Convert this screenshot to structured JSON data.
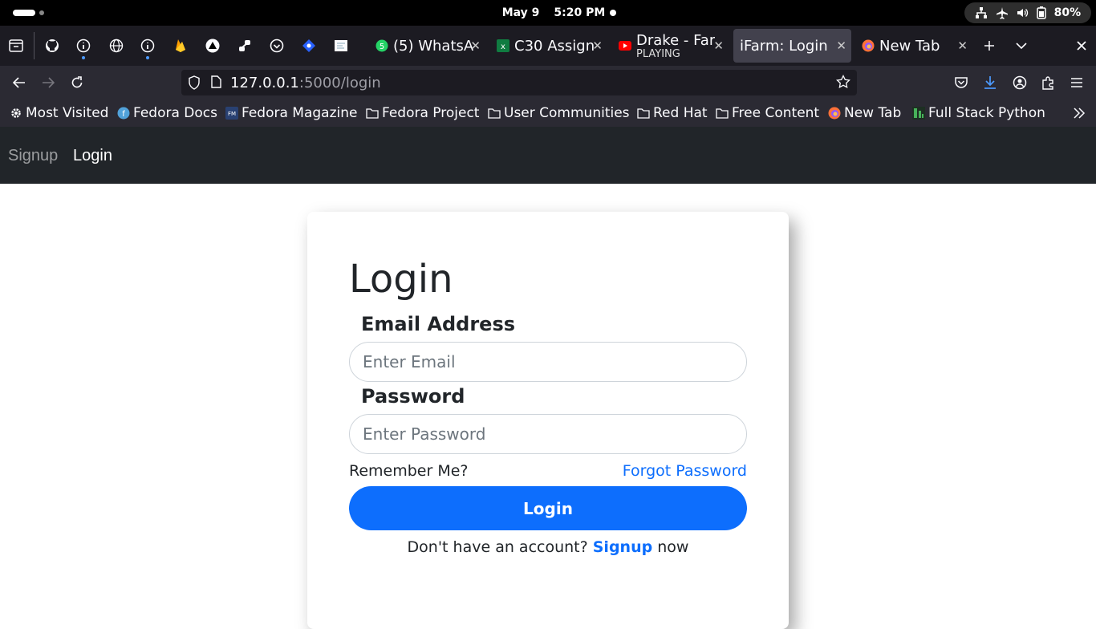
{
  "system": {
    "date": "May 9",
    "time": "5:20 PM",
    "battery": "80%"
  },
  "browser": {
    "tabs": [
      {
        "title": "(5) WhatsA",
        "icon": "whatsapp-icon"
      },
      {
        "title": "C30 Assign",
        "icon": "excel-icon"
      },
      {
        "title": "Drake - Far",
        "subtitle": "PLAYING",
        "icon": "youtube-icon"
      },
      {
        "title": "iFarm: Login",
        "icon": "none"
      },
      {
        "title": "New Tab",
        "icon": "firefox-icon"
      }
    ],
    "url_host": "127.0.0.1",
    "url_path": ":5000/login",
    "bookmarks": [
      "Most Visited",
      "Fedora Docs",
      "Fedora Magazine",
      "Fedora Project",
      "User Communities",
      "Red Hat",
      "Free Content",
      "New Tab",
      "Full Stack Python"
    ]
  },
  "app": {
    "nav": {
      "signup": "Signup",
      "login": "Login"
    },
    "form": {
      "title": "Login",
      "email_label": "Email Address",
      "email_placeholder": "Enter Email",
      "password_label": "Password",
      "password_placeholder": "Enter Password",
      "remember": "Remember Me?",
      "forgot": "Forgot Password",
      "submit": "Login",
      "signup_prefix": "Don't have an account?",
      "signup_link": "Signup",
      "signup_suffix": "now"
    },
    "colors": {
      "primary": "#0d6efd",
      "navbar": "#212529"
    }
  }
}
